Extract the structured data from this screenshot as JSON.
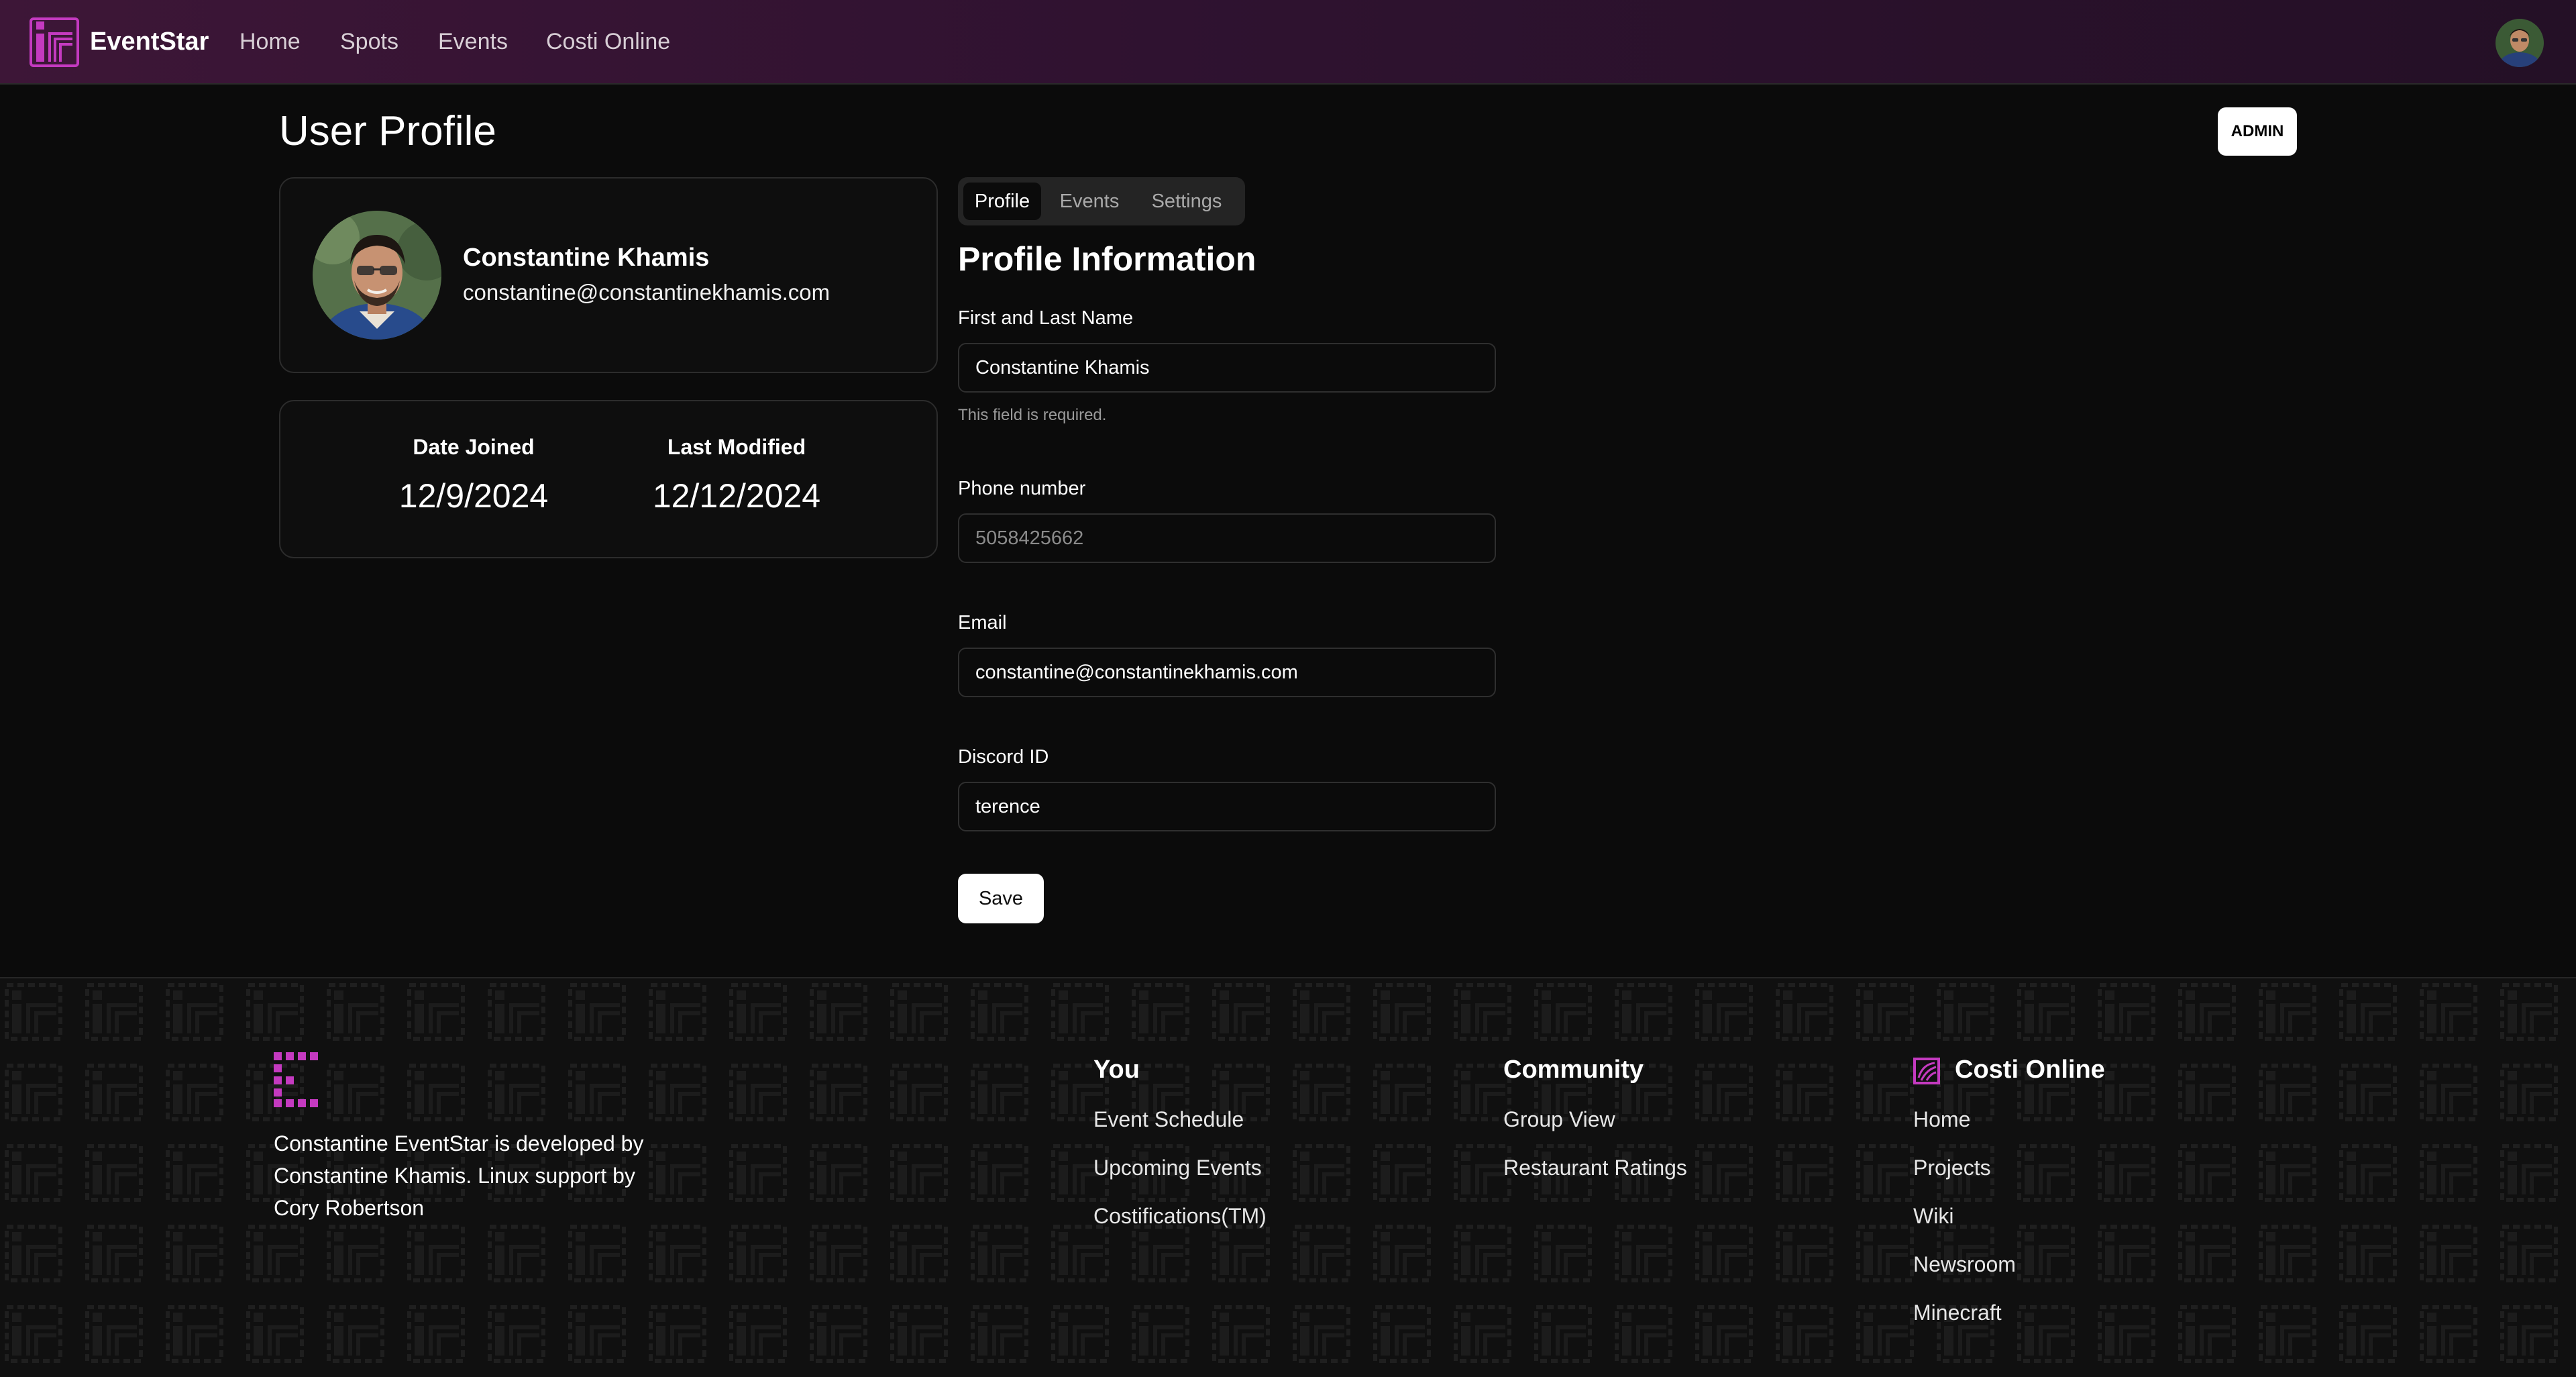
{
  "app": {
    "brand": "EventStar",
    "accent_color": "#c43ac0",
    "nav": [
      {
        "label": "Home"
      },
      {
        "label": "Spots"
      },
      {
        "label": "Events"
      },
      {
        "label": "Costi Online"
      }
    ],
    "user_avatar_icon": "user-avatar"
  },
  "header": {
    "title": "User Profile",
    "role_badge": "ADMIN"
  },
  "profile_card": {
    "name": "Constantine Khamis",
    "email": "constantine@constantinekhamis.com"
  },
  "dates_card": {
    "joined_label": "Date Joined",
    "joined_value": "12/9/2024",
    "modified_label": "Last Modified",
    "modified_value": "12/12/2024"
  },
  "tabs": [
    {
      "label": "Profile",
      "active": true
    },
    {
      "label": "Events",
      "active": false
    },
    {
      "label": "Settings",
      "active": false
    }
  ],
  "form": {
    "title": "Profile Information",
    "name_label": "First and Last Name",
    "name_value": "Constantine Khamis",
    "name_hint": "This field is required.",
    "phone_label": "Phone number",
    "phone_placeholder": "5058425662",
    "email_label": "Email",
    "email_value": "constantine@constantinekhamis.com",
    "discord_label": "Discord ID",
    "discord_value": "terence",
    "save_label": "Save"
  },
  "footer": {
    "about": "Constantine EventStar is developed by Constantine Khamis. Linux support by Cory Robertson",
    "you": {
      "heading": "You",
      "links": [
        "Event Schedule",
        "Upcoming Events",
        "Costifications(TM)"
      ]
    },
    "community": {
      "heading": "Community",
      "links": [
        "Group View",
        "Restaurant Ratings"
      ]
    },
    "costi": {
      "heading": "Costi Online",
      "icon": "costi-online-icon",
      "links": [
        "Home",
        "Projects",
        "Wiki",
        "Newsroom",
        "Minecraft"
      ]
    }
  }
}
